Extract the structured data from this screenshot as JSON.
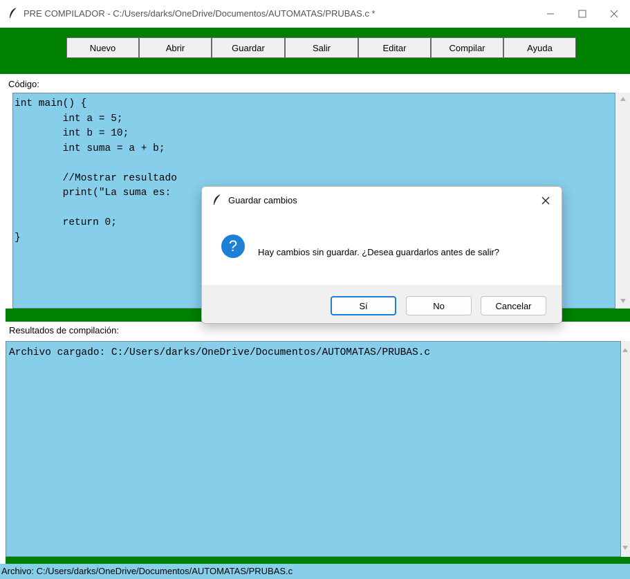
{
  "window": {
    "title": "PRE COMPILADOR - C:/Users/darks/OneDrive/Documentos/AUTOMATAS/PRUBAS.c *",
    "app_icon": "feather-icon",
    "minimize_icon": "minimize-icon",
    "maximize_icon": "maximize-icon",
    "close_icon": "close-icon"
  },
  "toolbar": {
    "background": "#008000",
    "buttons": [
      {
        "label": "Nuevo"
      },
      {
        "label": "Abrir"
      },
      {
        "label": "Guardar"
      },
      {
        "label": "Salir"
      },
      {
        "label": "Editar"
      },
      {
        "label": "Compilar"
      },
      {
        "label": "Ayuda"
      }
    ]
  },
  "code_section": {
    "label": "Código:",
    "background": "#87ceeb",
    "content": "int main() {\n        int a = 5;\n        int b = 10;\n        int suma = a + b;\n\n        //Mostrar resultado\n        print(\"La suma es:\n\n        return 0;\n}"
  },
  "results_section": {
    "label": "Resultados de compilación:",
    "content": "Archivo cargado: C:/Users/darks/OneDrive/Documentos/AUTOMATAS/PRUBAS.c"
  },
  "status_bar": {
    "text": "Archivo: C:/Users/darks/OneDrive/Documentos/AUTOMATAS/PRUBAS.c"
  },
  "dialog": {
    "title": "Guardar cambios",
    "icon": "question-icon",
    "icon_glyph": "?",
    "message": "Hay cambios sin guardar. ¿Desea guardarlos antes de salir?",
    "buttons": {
      "yes": "Sí",
      "no": "No",
      "cancel": "Cancelar"
    }
  }
}
